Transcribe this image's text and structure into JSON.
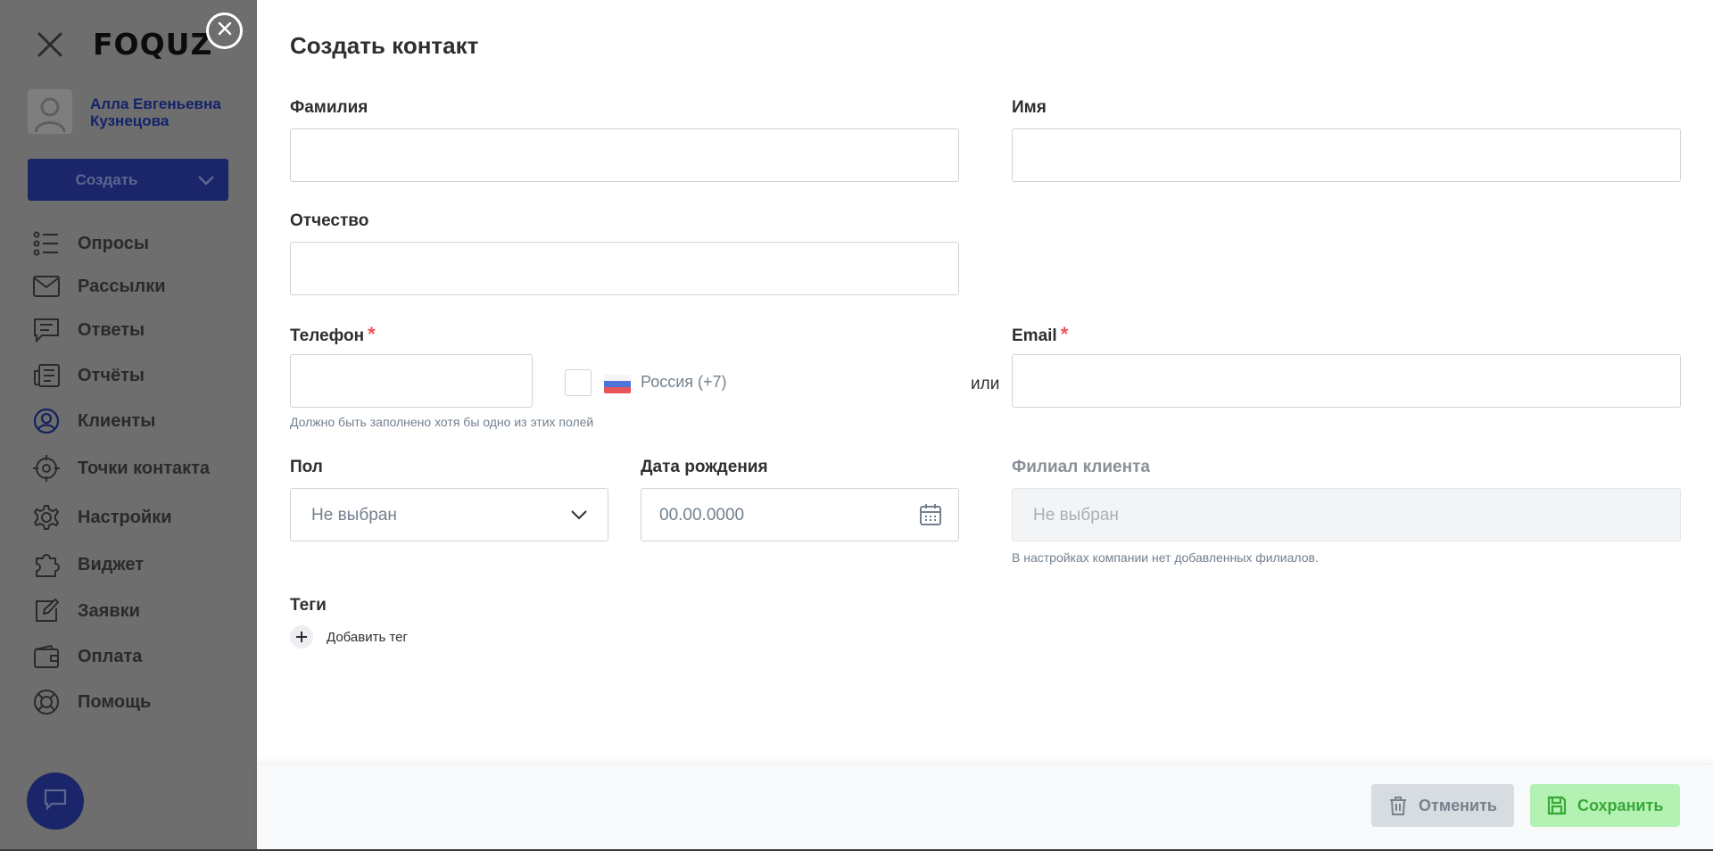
{
  "sidebar": {
    "logo": "FOQUZ",
    "user_name": "Алла Евгеньевна Кузнецова",
    "create_label": "Создать",
    "nav": [
      {
        "label": "Опросы",
        "icon": "list-icon"
      },
      {
        "label": "Рассылки",
        "icon": "mail-icon"
      },
      {
        "label": "Ответы",
        "icon": "answers-icon"
      },
      {
        "label": "Отчёты",
        "icon": "reports-icon"
      },
      {
        "label": "Клиенты",
        "icon": "user-circle-icon"
      },
      {
        "label": "Точки контакта",
        "icon": "target-icon"
      },
      {
        "label": "Настройки",
        "icon": "gear-icon"
      },
      {
        "label": "Виджет",
        "icon": "puzzle-icon"
      },
      {
        "label": "Заявки",
        "icon": "edit-icon"
      },
      {
        "label": "Оплата",
        "icon": "wallet-icon"
      },
      {
        "label": "Помощь",
        "icon": "lifebuoy-icon"
      }
    ]
  },
  "form": {
    "title": "Создать контакт",
    "last_name_label": "Фамилия",
    "first_name_label": "Имя",
    "middle_name_label": "Отчество",
    "phone_label": "Телефон",
    "required_mark": "*",
    "country": "Россия (+7)",
    "or_label": "или",
    "email_label": "Email",
    "contact_hint": "Должно быть заполнено хотя бы одно из этих полей",
    "gender_label": "Пол",
    "gender_value": "Не выбран",
    "birth_label": "Дата рождения",
    "birth_placeholder": "00.00.0000",
    "branch_label": "Филиал клиента",
    "branch_value": "Не выбран",
    "branch_hint": "В настройках компании нет добавленных филиалов.",
    "tags_label": "Теги",
    "add_tag_label": "Добавить тег"
  },
  "footer": {
    "cancel_label": "Отменить",
    "save_label": "Сохранить"
  },
  "colors": {
    "sidebar_overlay": "#6e6e6e",
    "brand": "#1a2669",
    "required": "#f2545b",
    "save_bg": "#b4f2b4",
    "save_text": "#37a838",
    "cancel_bg": "#d7dce0"
  }
}
